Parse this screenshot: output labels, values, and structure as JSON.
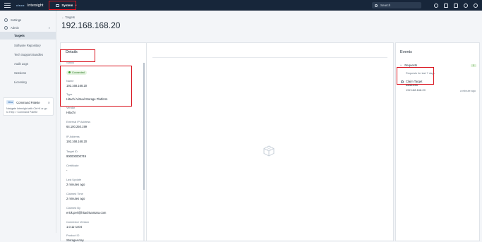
{
  "topbar": {
    "logo": "cisco",
    "brand": "Intersight",
    "system_label": "System",
    "search_placeholder": "Search",
    "icons": [
      "checkmark-icon",
      "megaphone-icon",
      "bell-icon",
      "help-icon",
      "user-icon"
    ]
  },
  "sidebar": {
    "settings": "Settings",
    "admin": "Admin",
    "items": [
      "Targets",
      "Software Repository",
      "Tech Support Bundles",
      "Audit Logs",
      "Sessions",
      "Licensing"
    ],
    "command_palette": {
      "badge": "New",
      "title": "Command Palette",
      "text_1": "Navigate Intersight with Ctrl+K or go",
      "text_2": "to Help > Command Palette"
    }
  },
  "page": {
    "breadcrumb": "← Targets",
    "title": "192.168.168.20"
  },
  "details": {
    "heading": "Details",
    "status_label": "Status",
    "status_value": "Connected",
    "fields": [
      {
        "label": "Name",
        "value": "192.168.168.20"
      },
      {
        "label": "Type",
        "value": "Hitachi Virtual Storage Platform"
      },
      {
        "label": "Vendor",
        "value": "Hitachi"
      },
      {
        "label": "External IP Address",
        "value": "64.100.250.199"
      },
      {
        "label": "IP Address",
        "value": "192.168.168.20"
      },
      {
        "label": "Target ID",
        "value": "900000000749"
      },
      {
        "label": "Certificate",
        "value": "-"
      },
      {
        "label": "Last Update",
        "value": "2 minutes ago"
      },
      {
        "label": "Claimed Time",
        "value": "2 minutes ago"
      },
      {
        "label": "Claimed By",
        "value": "erick.perl@hitachivantara.com"
      },
      {
        "label": "Connector Version",
        "value": "1.0.11-1404"
      },
      {
        "label": "Product ID",
        "value": "StorageArray"
      }
    ]
  },
  "events": {
    "heading": "Events",
    "requests_label": "Requests",
    "requests_count": "1",
    "requests_sub": "Requests for last 7 days",
    "item_title_1": "Claim Target",
    "item_title_2": "Business",
    "item_sub": "192.168.168.20",
    "item_time": "a minute ago"
  }
}
